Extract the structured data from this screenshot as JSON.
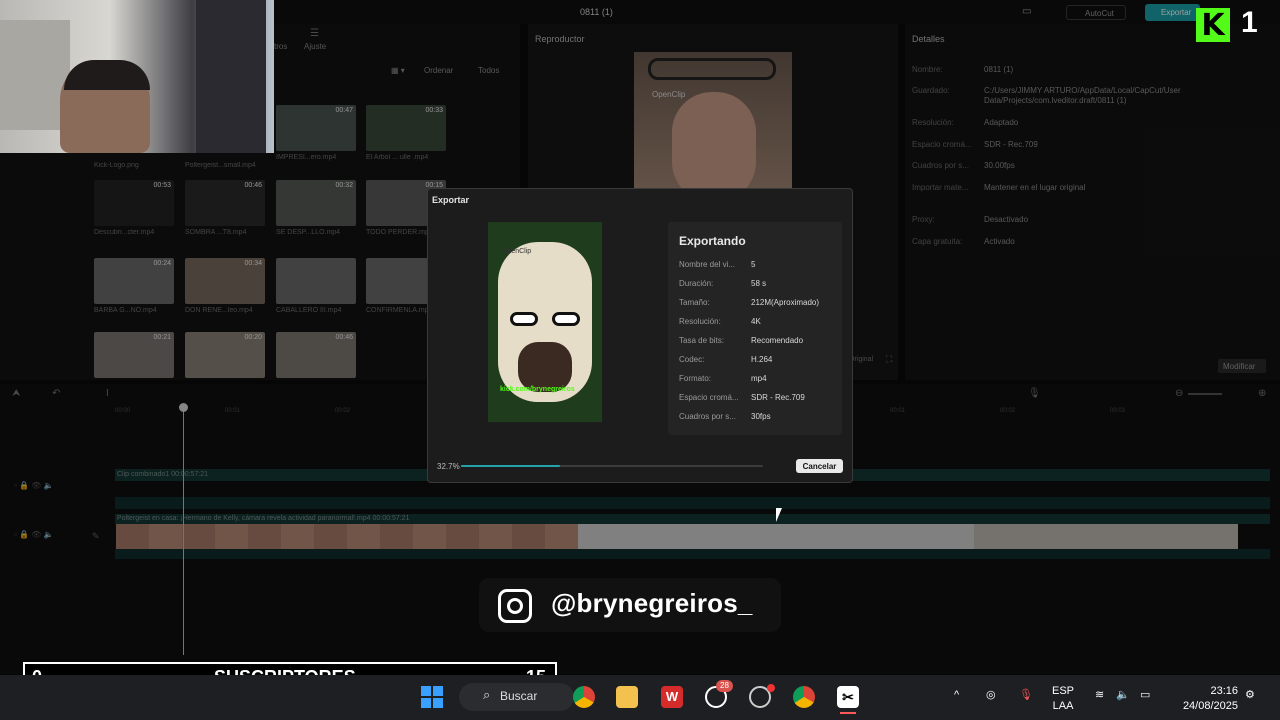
{
  "app": {
    "title": "0811 (1)",
    "autocut_label": "AutoCut",
    "export_label": "Exportar"
  },
  "media": {
    "tab_filters": "tros",
    "tab_adjust": "Ajuste",
    "sort_label": "Ordenar",
    "filter_label": "Todos",
    "items": [
      {
        "label": "Kick-Logo.png",
        "duration": ""
      },
      {
        "label": "Poltergeist...small.mp4",
        "duration": ""
      },
      {
        "label": "IMPRESI...ero.mp4",
        "duration": "00:47"
      },
      {
        "label": "El Arbol ... ulle .mp4",
        "duration": "00:33"
      },
      {
        "label": "Descubri...cter.mp4",
        "duration": "00:53"
      },
      {
        "label": "SOMBRA ...T8.mp4",
        "duration": "00:46"
      },
      {
        "label": "SE DESP...LLO.mp4",
        "duration": "00:32"
      },
      {
        "label": "TODO PERDER.mp4",
        "duration": "00:15"
      },
      {
        "label": "BARBA G...NO.mp4",
        "duration": "00:24"
      },
      {
        "label": "DON RENE...leo.mp4",
        "duration": "00:34"
      },
      {
        "label": "CABALLERO III.mp4",
        "duration": ""
      },
      {
        "label": "CONFIRMENLA.mp4",
        "duration": ""
      },
      {
        "label": "",
        "duration": "00:21"
      },
      {
        "label": "",
        "duration": "00:20"
      },
      {
        "label": "",
        "duration": "00:46"
      }
    ]
  },
  "player": {
    "title": "Reproductor",
    "original_label": "Original",
    "watermark": "OpenClip"
  },
  "details": {
    "title": "Detalles",
    "rows": [
      {
        "key": "Nombre:",
        "value": "0811 (1)"
      },
      {
        "key": "Guardado:",
        "value": "C:/Users/JIMMY ARTURO/AppData/Local/CapCut/User Data/Projects/com.lveditor.draft/0811 (1)"
      },
      {
        "key": "Resolución:",
        "value": "Adaptado"
      },
      {
        "key": "Espacio cromá...",
        "value": "SDR - Rec.709"
      },
      {
        "key": "Cuadros por s...",
        "value": "30.00fps"
      },
      {
        "key": "Importar mate...",
        "value": "Mantener en el lugar original"
      },
      {
        "key": "Proxy:",
        "value": "Desactivado"
      },
      {
        "key": "Capa gratuita:",
        "value": "Activado"
      }
    ],
    "modify_label": "Modificar"
  },
  "timeline": {
    "ruler": [
      "00:00",
      "00:01",
      "00:02",
      "00:01",
      "00:02",
      "00:03"
    ],
    "track1_label": "Clip combinado1   00:00:57:21",
    "track2_label": "Poltergeist en casa: ¡Hermano de Kelly, cámara revela actividad paranormal!.mp4   00:00:57:21"
  },
  "export_dialog": {
    "title": "Exportar",
    "status": "Exportando",
    "rows": [
      {
        "key": "Nombre del vi...",
        "value": "5"
      },
      {
        "key": "Duración:",
        "value": "58 s"
      },
      {
        "key": "Tamaño:",
        "value": "212M(Aproximado)"
      },
      {
        "key": "Resolución:",
        "value": "4K"
      },
      {
        "key": "Tasa de bits:",
        "value": "Recomendado"
      },
      {
        "key": "Codec:",
        "value": "H.264"
      },
      {
        "key": "Formato:",
        "value": "mp4"
      },
      {
        "key": "Espacio cromá...",
        "value": "SDR - Rec.709"
      },
      {
        "key": "Cuadros por s...",
        "value": "30fps"
      }
    ],
    "progress_label": "32.7%",
    "progress_value": 0.327,
    "cancel_label": "Cancelar",
    "preview_watermark": "OpenClip",
    "preview_caption": "kick.com/brynegreiros"
  },
  "overlays": {
    "kick_letter": "K",
    "kick_count": "1",
    "instagram_handle": "@brynegreiros_",
    "subs_left": "0",
    "subs_label": "SUSCRIPTORES",
    "subs_right": "15"
  },
  "taskbar": {
    "search_label": "Buscar",
    "whatsapp_badge": "28",
    "lang_top": "ESP",
    "lang_bottom": "LAA",
    "time": "23:16",
    "date": "24/08/2025"
  },
  "colors": {
    "accent": "#1aa1a8",
    "kick_green": "#53fc18",
    "track_teal": "#123734"
  }
}
